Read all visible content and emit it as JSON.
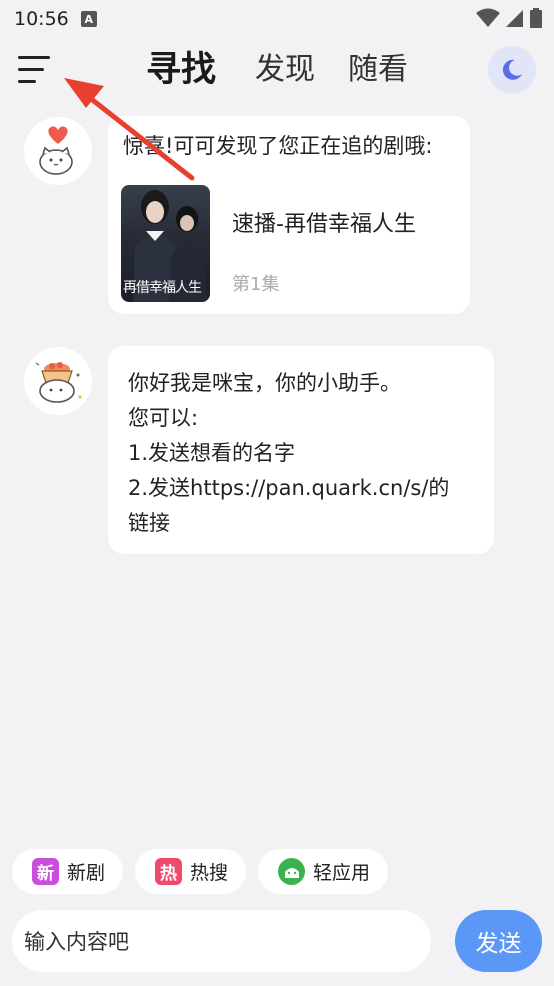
{
  "status_bar": {
    "time": "10:56",
    "notification_icon": "A"
  },
  "header": {
    "tabs": [
      {
        "label": "寻找",
        "active": true
      },
      {
        "label": "发现",
        "active": false
      },
      {
        "label": "随看",
        "active": false
      }
    ],
    "menu_icon": "hamburger-icon",
    "theme_icon": "moon-icon"
  },
  "messages": [
    {
      "avatar": "cat-heart-avatar",
      "text": "惊喜!可可发现了您正在追的剧哦:",
      "drama": {
        "poster_text": "再借幸福人生",
        "title": "速播-再借幸福人生",
        "episode": "第1集"
      }
    },
    {
      "avatar": "cat-basket-avatar",
      "lines": [
        "你好我是咪宝，你的小助手。",
        "您可以:",
        "1.发送想看的名字",
        "2.发送https://pan.quark.cn/s/的",
        "链接"
      ]
    }
  ],
  "chips": [
    {
      "icon_text": "新",
      "label": "新剧",
      "color": "#c94ed9"
    },
    {
      "icon_text": "热",
      "label": "热搜",
      "color": "#f0496e"
    },
    {
      "icon_text": "",
      "label": "轻应用",
      "color": "#3cb24c"
    }
  ],
  "input": {
    "placeholder": "输入内容吧"
  },
  "send_label": "发送",
  "colors": {
    "accent": "#5b97f6",
    "background": "#f2f2f4",
    "annotation_arrow": "#e8402f"
  }
}
